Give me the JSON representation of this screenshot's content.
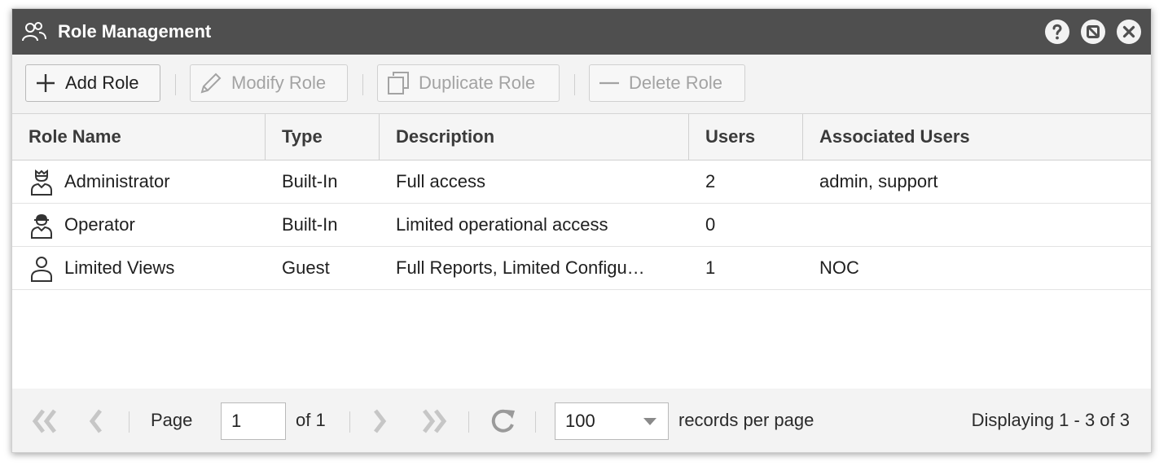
{
  "window": {
    "title": "Role Management",
    "icons": {
      "title": "users-icon",
      "help": "help-icon",
      "minimize": "minimize-icon",
      "close": "close-icon"
    }
  },
  "toolbar": {
    "add_label": "Add Role",
    "modify_label": "Modify Role",
    "duplicate_label": "Duplicate Role",
    "delete_label": "Delete Role"
  },
  "grid": {
    "columns": [
      "Role Name",
      "Type",
      "Description",
      "Users",
      "Associated Users"
    ],
    "rows": [
      {
        "icon": "admin-user-icon",
        "name": "Administrator",
        "type": "Built-In",
        "description": "Full access",
        "users": "2",
        "associated": "admin, support"
      },
      {
        "icon": "operator-user-icon",
        "name": "Operator",
        "type": "Built-In",
        "description": "Limited operational access",
        "users": "0",
        "associated": ""
      },
      {
        "icon": "guest-user-icon",
        "name": "Limited Views",
        "type": "Guest",
        "description": "Full Reports, Limited Configu…",
        "users": "1",
        "associated": "NOC"
      }
    ]
  },
  "pager": {
    "page_label": "Page",
    "page_value": "1",
    "of_label": "of 1",
    "per_page_value": "100",
    "per_page_label": "records per page",
    "display_text": "Displaying 1 - 3 of 3"
  },
  "colors": {
    "titlebar": "#4f4f4f",
    "toolbar": "#f3f3f3",
    "disabled_text": "#a3a3a3"
  }
}
